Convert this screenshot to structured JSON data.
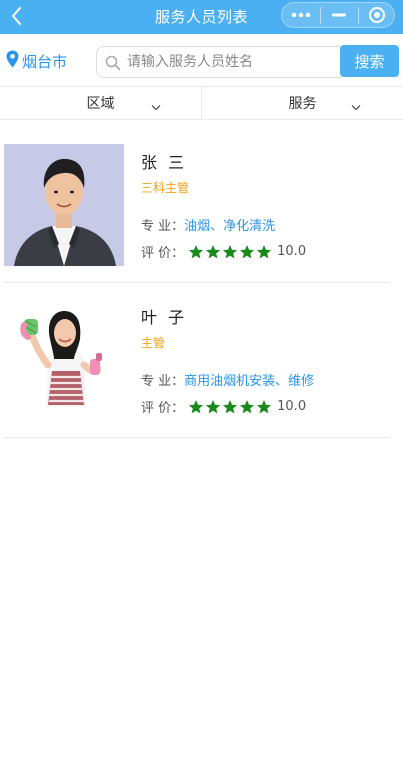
{
  "topbar": {
    "title": "服务人员列表",
    "icons": [
      "back-chevron-icon",
      "more-dots-icon",
      "minimize-icon",
      "close-target-icon"
    ]
  },
  "search": {
    "city": "烟台市",
    "placeholder": "请输入服务人员姓名",
    "value": "",
    "button_label": "搜索"
  },
  "filters": [
    {
      "label": "区域"
    },
    {
      "label": "服务"
    }
  ],
  "staff": [
    {
      "name": "张 三",
      "role": "三科主管",
      "specialty_label": "专 业：",
      "specialty": "油烟、净化清洗",
      "rating_label": "评 价：",
      "stars": 5,
      "score": "10.0",
      "photo": "man-in-suit-photo"
    },
    {
      "name": "叶 子",
      "role": "主管",
      "specialty_label": "专 业：",
      "specialty": "商用油烟机安装、维修",
      "rating_label": "评 价：",
      "stars": 5,
      "score": "10.0",
      "photo": "woman-cleaner-photo"
    }
  ],
  "colors": {
    "primary": "#4bb0f2",
    "link": "#2b95e8",
    "role": "#f0a21a",
    "star": "#1a8a1a"
  }
}
